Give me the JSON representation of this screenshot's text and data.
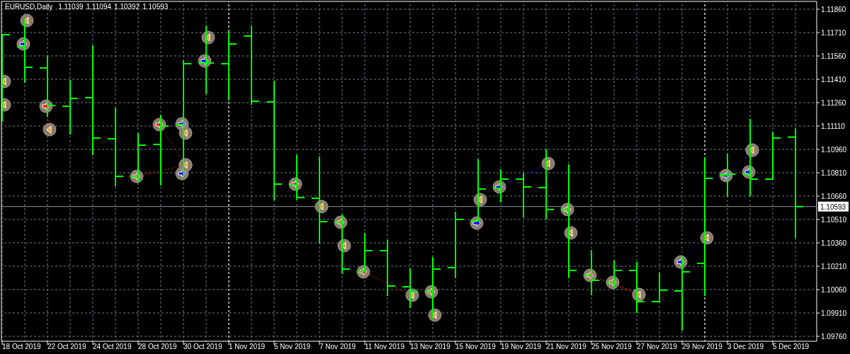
{
  "chart": {
    "symbol": "EURUSD,Daily",
    "ohlc": [
      "1.11039",
      "1.11094",
      "1.10392",
      "1.10593"
    ],
    "current_price": "1.10593",
    "price_axis": [
      "1.11860",
      "1.11710",
      "1.11560",
      "1.11410",
      "1.11260",
      "1.11110",
      "1.10960",
      "1.10810",
      "1.10660",
      "1.10510",
      "1.10360",
      "1.10210",
      "1.10060",
      "1.09910",
      "1.09760"
    ],
    "time_axis": [
      "18 Oct 2019",
      "22 Oct 2019",
      "24 Oct 2019",
      "28 Oct 2019",
      "30 Oct 2019",
      "1 Nov 2019",
      "5 Nov 2019",
      "7 Nov 2019",
      "11 Nov 2019",
      "13 Nov 2019",
      "15 Nov 2019",
      "19 Nov 2019",
      "21 Nov 2019",
      "25 Nov 2019",
      "27 Nov 2019",
      "29 Nov 2019",
      "3 Dec 2019",
      "5 Dec 2019"
    ]
  }
}
